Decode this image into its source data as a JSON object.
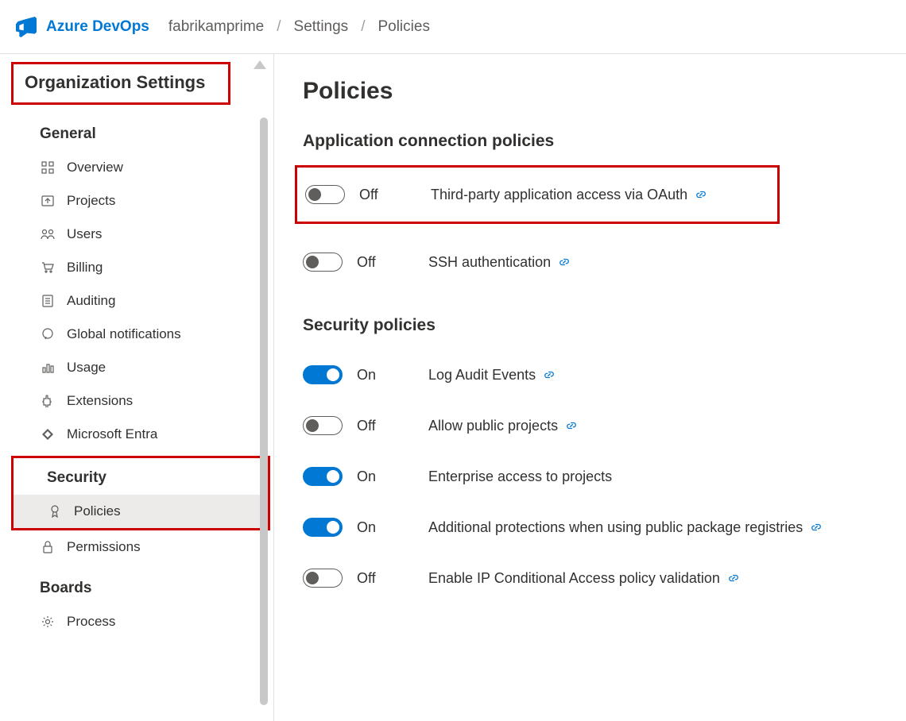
{
  "header": {
    "brand": "Azure DevOps",
    "breadcrumb": [
      "fabrikamprime",
      "Settings",
      "Policies"
    ]
  },
  "sidebar": {
    "title": "Organization Settings",
    "sections": [
      {
        "title": "General",
        "items": [
          {
            "label": "Overview",
            "icon": "grid-icon"
          },
          {
            "label": "Projects",
            "icon": "upload-icon"
          },
          {
            "label": "Users",
            "icon": "users-icon"
          },
          {
            "label": "Billing",
            "icon": "cart-icon"
          },
          {
            "label": "Auditing",
            "icon": "document-icon"
          },
          {
            "label": "Global notifications",
            "icon": "chat-icon"
          },
          {
            "label": "Usage",
            "icon": "chart-icon"
          },
          {
            "label": "Extensions",
            "icon": "puzzle-icon"
          },
          {
            "label": "Microsoft Entra",
            "icon": "diamond-icon"
          }
        ]
      },
      {
        "title": "Security",
        "items": [
          {
            "label": "Policies",
            "icon": "badge-icon",
            "active": true
          },
          {
            "label": "Permissions",
            "icon": "lock-icon"
          }
        ]
      },
      {
        "title": "Boards",
        "items": [
          {
            "label": "Process",
            "icon": "gear-icon"
          }
        ]
      }
    ]
  },
  "main": {
    "title": "Policies",
    "groups": [
      {
        "title": "Application connection policies",
        "policies": [
          {
            "state": "off",
            "state_label": "Off",
            "label": "Third-party application access via OAuth",
            "has_link": true,
            "highlight": true
          },
          {
            "state": "off",
            "state_label": "Off",
            "label": "SSH authentication",
            "has_link": true
          }
        ]
      },
      {
        "title": "Security policies",
        "policies": [
          {
            "state": "on",
            "state_label": "On",
            "label": "Log Audit Events",
            "has_link": true
          },
          {
            "state": "off",
            "state_label": "Off",
            "label": "Allow public projects",
            "has_link": true
          },
          {
            "state": "on",
            "state_label": "On",
            "label": "Enterprise access to projects",
            "has_link": false
          },
          {
            "state": "on",
            "state_label": "On",
            "label": "Additional protections when using public package registries",
            "has_link": true
          },
          {
            "state": "off",
            "state_label": "Off",
            "label": "Enable IP Conditional Access policy validation",
            "has_link": true
          }
        ]
      }
    ]
  }
}
